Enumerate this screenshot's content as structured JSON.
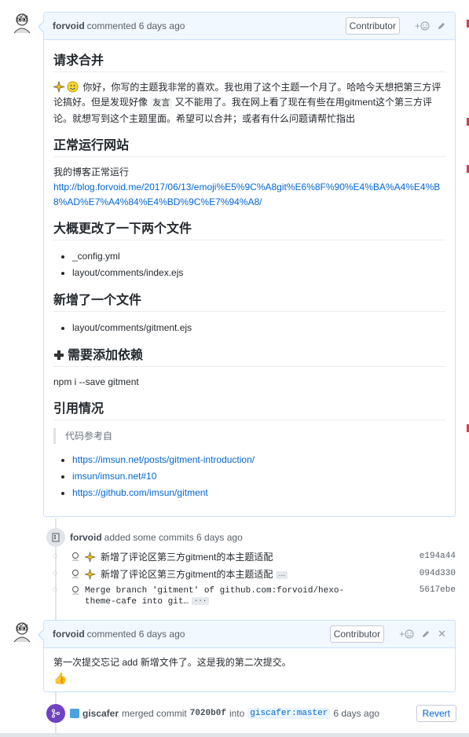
{
  "comment1": {
    "author": "forvoid",
    "action": "commented 6 days ago",
    "badge": "Contributor",
    "h_merge": "请求合并",
    "intro_a": "你好，你写的主题我非常的喜欢。我也用了这个主题一个月了。哈哈今天想把第三方评论搞好。但是发现好像",
    "intro_code": "友言",
    "intro_b": "又不能用了。我在网上看了现在有些在用gitment这个第三方评论。就想写到这个主题里面。希望可以合并；或者有什么问题请帮忙指出",
    "h_running": "正常运行网站",
    "blog_label": "我的博客正常运行",
    "blog_url": "http://blog.forvoid.me/2017/06/13/emoji%E5%9C%A8git%E6%8F%90%E4%BA%A4%E4%B8%AD%E7%A4%84%E4%BD%9C%E7%94%A8/",
    "h_changed": "大概更改了一下两个文件",
    "changed_files": [
      "_config.yml",
      "layout/comments/index.ejs"
    ],
    "h_added": "新增了一个文件",
    "added_files": [
      "layout/comments/gitment.ejs"
    ],
    "h_deps": "需要添加依赖",
    "dep_cmd": "npm i --save gitment",
    "h_refs": "引用情况",
    "quote": "代码参考自",
    "refs": [
      "https://imsun.net/posts/gitment-introduction/",
      "imsun/imsun.net#10",
      "https://github.com/imsun/gitment"
    ]
  },
  "commits_event": {
    "author": "forvoid",
    "action": "added some commits 6 days ago",
    "commits": [
      {
        "msg": "新增了评论区第三方gitment的本主题适配",
        "sha": "e194a44",
        "ellipsis": false
      },
      {
        "msg": "新增了评论区第三方gitment的本主题适配",
        "sha": "094d330",
        "ellipsis": true
      },
      {
        "msg": "Merge branch 'gitment' of github.com:forvoid/hexo-theme-cafe into git…",
        "sha": "5617ebe",
        "ellipsis": true
      }
    ]
  },
  "comment2": {
    "author": "forvoid",
    "action": "commented 6 days ago",
    "badge": "Contributor",
    "body": "第一次提交忘记 add 新增文件了。这是我的第二次提交。",
    "reaction": "👍"
  },
  "merge": {
    "actor": "giscafer",
    "text_a": "merged commit",
    "sha": "7020b0f",
    "text_b": "into",
    "branch": "giscafer:master",
    "time": "6 days ago",
    "revert_label": "Revert"
  },
  "colors": {
    "link": "#0366d6",
    "header_bg": "#f1f8ff",
    "border": "#c8e1ff",
    "merge": "#6f42c1"
  }
}
